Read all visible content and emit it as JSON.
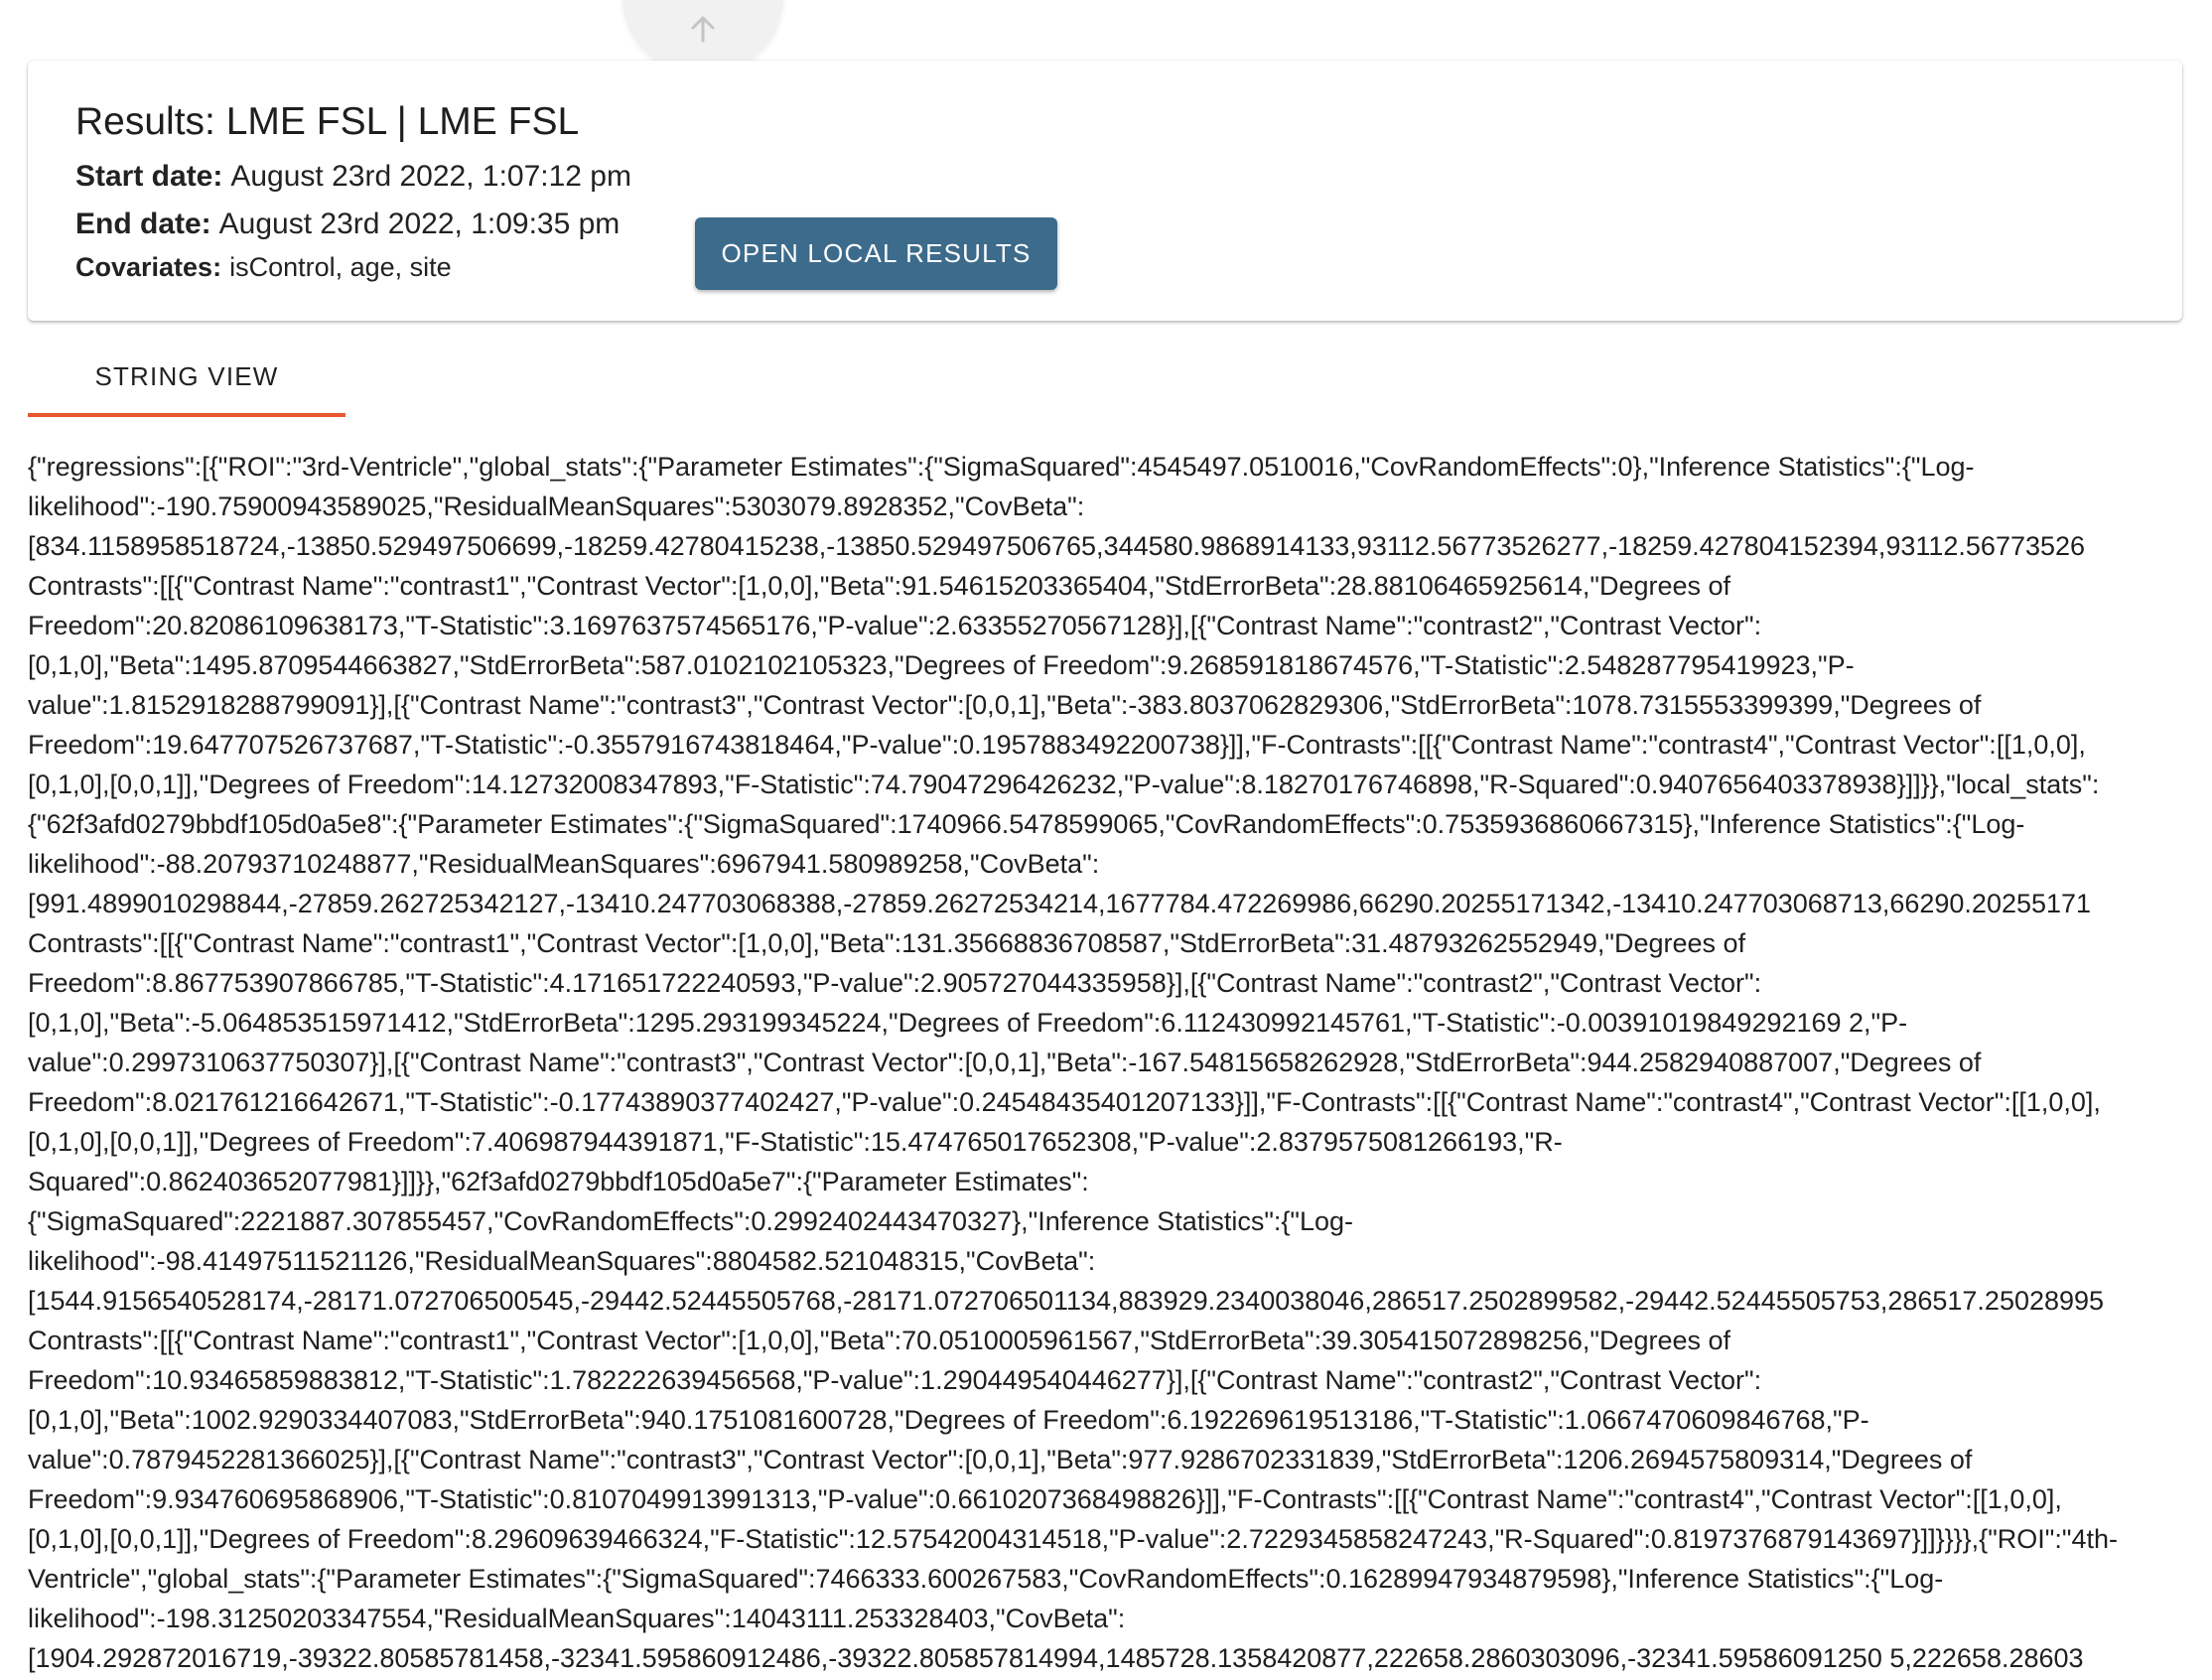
{
  "header": {
    "title": "Results: LME FSL | LME FSL",
    "start_label": "Start date:",
    "start_value": "August 23rd 2022, 1:07:12 pm",
    "end_label": "End date:",
    "end_value": "August 23rd 2022, 1:09:35 pm",
    "covariates_label": "Covariates:",
    "covariates_value": "isControl, age, site",
    "open_button_label": "OPEN LOCAL RESULTS"
  },
  "tabs": [
    {
      "label": "STRING VIEW",
      "selected": true
    }
  ],
  "icons": {
    "scroll_top": "arrow-up-icon"
  },
  "colors": {
    "button": "#3d6b8b",
    "tab_indicator": "#e8572d"
  },
  "result_lines": [
    "{\"regressions\":[{\"ROI\":\"3rd-Ventricle\",\"global_stats\":{\"Parameter Estimates\":{\"SigmaSquared\":4545497.0510016,\"CovRandomEffects\":0},\"Inference Statistics\":{\"Log-",
    "likelihood\":-190.75900943589025,\"ResidualMeanSquares\":5303079.8928352,\"CovBeta\":",
    "[834.1158958518724,-13850.529497506699,-18259.42780415238,-13850.529497506765,344580.9868914133,93112.56773526277,-18259.427804152394,93112.56773526",
    "Contrasts\":[[{\"Contrast Name\":\"contrast1\",\"Contrast Vector\":[1,0,0],\"Beta\":91.54615203365404,\"StdErrorBeta\":28.88106465925614,\"Degrees of",
    "Freedom\":20.82086109638173,\"T-Statistic\":3.1697637574565176,\"P-value\":2.63355270567128}],[{\"Contrast Name\":\"contrast2\",\"Contrast Vector\":",
    "[0,1,0],\"Beta\":1495.8709544663827,\"StdErrorBeta\":587.0102102105323,\"Degrees of Freedom\":9.268591818674576,\"T-Statistic\":2.548287795419923,\"P-",
    "value\":1.8152918288799091}],[{\"Contrast Name\":\"contrast3\",\"Contrast Vector\":[0,0,1],\"Beta\":-383.8037062829306,\"StdErrorBeta\":1078.7315553399399,\"Degrees of",
    "Freedom\":19.647707526737687,\"T-Statistic\":-0.3557916743818464,\"P-value\":0.1957883492200738}]],\"F-Contrasts\":[[{\"Contrast Name\":\"contrast4\",\"Contrast Vector\":[[1,0,0],",
    "[0,1,0],[0,0,1]],\"Degrees of Freedom\":14.12732008347893,\"F-Statistic\":74.79047296426232,\"P-value\":8.18270176746898,\"R-Squared\":0.9407656403378938}]]}},\"local_stats\":",
    "{\"62f3afd0279bbdf105d0a5e8\":{\"Parameter Estimates\":{\"SigmaSquared\":1740966.5478599065,\"CovRandomEffects\":0.7535936860667315},\"Inference Statistics\":{\"Log-",
    "likelihood\":-88.20793710248877,\"ResidualMeanSquares\":6967941.580989258,\"CovBeta\":",
    "[991.4899010298844,-27859.262725342127,-13410.247703068388,-27859.26272534214,1677784.472269986,66290.20255171342,-13410.247703068713,66290.20255171",
    "Contrasts\":[[{\"Contrast Name\":\"contrast1\",\"Contrast Vector\":[1,0,0],\"Beta\":131.35668836708587,\"StdErrorBeta\":31.48793262552949,\"Degrees of",
    "Freedom\":8.867753907866785,\"T-Statistic\":4.171651722240593,\"P-value\":2.905727044335958}],[{\"Contrast Name\":\"contrast2\",\"Contrast Vector\":",
    "[0,1,0],\"Beta\":-5.064853515971412,\"StdErrorBeta\":1295.293199345224,\"Degrees of Freedom\":6.112430992145761,\"T-Statistic\":-0.00391019849292169 2,\"P-",
    "value\":0.2997310637750307}],[{\"Contrast Name\":\"contrast3\",\"Contrast Vector\":[0,0,1],\"Beta\":-167.54815658262928,\"StdErrorBeta\":944.2582940887007,\"Degrees of",
    "Freedom\":8.021761216642671,\"T-Statistic\":-0.17743890377402427,\"P-value\":0.24548435401207133}]],\"F-Contrasts\":[[{\"Contrast Name\":\"contrast4\",\"Contrast Vector\":[[1,0,0],",
    "[0,1,0],[0,0,1]],\"Degrees of Freedom\":7.406987944391871,\"F-Statistic\":15.474765017652308,\"P-value\":2.8379575081266193,\"R-",
    "Squared\":0.862403652077981}]]}},\"62f3afd0279bbdf105d0a5e7\":{\"Parameter Estimates\":",
    "{\"SigmaSquared\":2221887.307855457,\"CovRandomEffects\":0.2992402443470327},\"Inference Statistics\":{\"Log-",
    "likelihood\":-98.41497511521126,\"ResidualMeanSquares\":8804582.521048315,\"CovBeta\":",
    "[1544.9156540528174,-28171.072706500545,-29442.52445505768,-28171.072706501134,883929.2340038046,286517.2502899582,-29442.52445505753,286517.25028995",
    "Contrasts\":[[{\"Contrast Name\":\"contrast1\",\"Contrast Vector\":[1,0,0],\"Beta\":70.0510005961567,\"StdErrorBeta\":39.305415072898256,\"Degrees of",
    "Freedom\":10.93465859883812,\"T-Statistic\":1.782222639456568,\"P-value\":1.290449540446277}],[{\"Contrast Name\":\"contrast2\",\"Contrast Vector\":",
    "[0,1,0],\"Beta\":1002.9290334407083,\"StdErrorBeta\":940.1751081600728,\"Degrees of Freedom\":6.192269619513186,\"T-Statistic\":1.0667470609846768,\"P-",
    "value\":0.7879452281366025}],[{\"Contrast Name\":\"contrast3\",\"Contrast Vector\":[0,0,1],\"Beta\":977.9286702331839,\"StdErrorBeta\":1206.2694575809314,\"Degrees of",
    "Freedom\":9.934760695868906,\"T-Statistic\":0.8107049913991313,\"P-value\":0.6610207368498826}]],\"F-Contrasts\":[[{\"Contrast Name\":\"contrast4\",\"Contrast Vector\":[[1,0,0],",
    "[0,1,0],[0,0,1]],\"Degrees of Freedom\":8.29609639466324,\"F-Statistic\":12.57542004314518,\"P-value\":2.7229345858247243,\"R-Squared\":0.8197376879143697}]]}}}},{\"ROI\":\"4th-",
    "Ventricle\",\"global_stats\":{\"Parameter Estimates\":{\"SigmaSquared\":7466333.600267583,\"CovRandomEffects\":0.16289947934879598},\"Inference Statistics\":{\"Log-",
    "likelihood\":-198.31250203347554,\"ResidualMeanSquares\":14043111.253328403,\"CovBeta\":",
    "[1904.292872016719,-39322.80585781458,-32341.595860912486,-39322.805857814994,1485728.1358420877,222658.2860303096,-32341.59586091250 5,222658.28603"
  ]
}
